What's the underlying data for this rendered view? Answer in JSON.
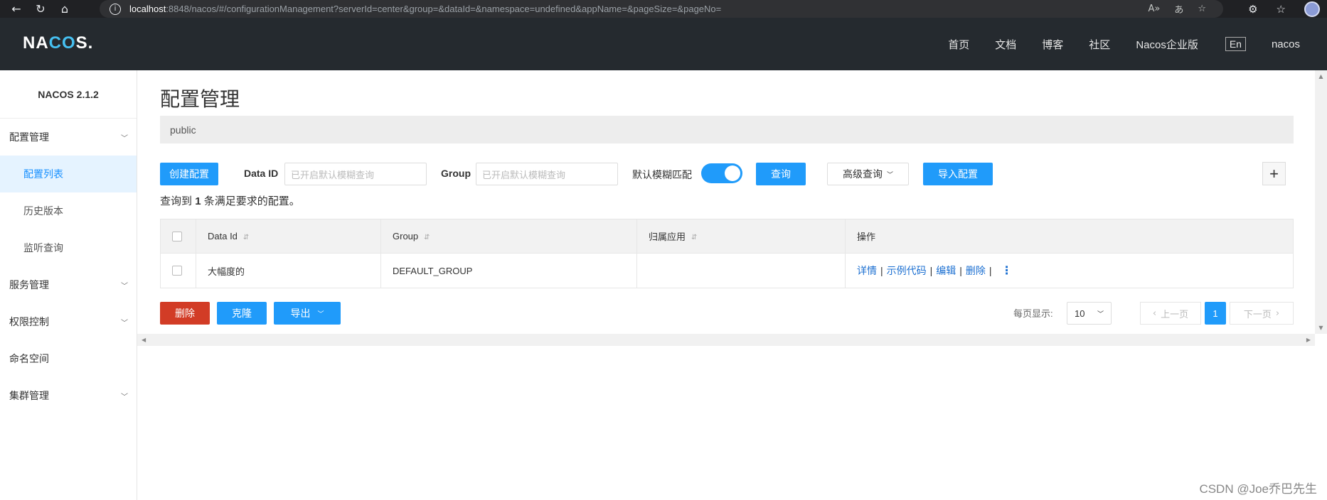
{
  "browser": {
    "back_icon": "arrow-left-icon",
    "url_host": "localhost",
    "url_path": ":8848/nacos/#/configurationManagement?serverId=center&group=&dataId=&namespace=undefined&appName=&pageSize=&pageNo="
  },
  "header": {
    "logo": "NACOS.",
    "nav": [
      "首页",
      "文档",
      "博客",
      "社区",
      "Nacos企业版"
    ],
    "lang": "En",
    "user": "nacos"
  },
  "sidebar": {
    "version": "NACOS 2.1.2",
    "items": [
      {
        "label": "配置管理",
        "expandable": true
      },
      {
        "label": "配置列表",
        "active": true
      },
      {
        "label": "历史版本"
      },
      {
        "label": "监听查询"
      },
      {
        "label": "服务管理",
        "expandable": true
      },
      {
        "label": "权限控制",
        "expandable": true
      },
      {
        "label": "命名空间",
        "expandable": false
      },
      {
        "label": "集群管理",
        "expandable": true
      }
    ]
  },
  "main": {
    "title": "配置管理",
    "namespace": "public",
    "toolbar": {
      "create_label": "创建配置",
      "dataid_label": "Data ID",
      "dataid_placeholder": "已开启默认模糊查询",
      "group_label": "Group",
      "group_placeholder": "已开启默认模糊查询",
      "fuzzy_label": "默认模糊匹配",
      "fuzzy_on": true,
      "query_label": "查询",
      "advanced_label": "高级查询",
      "import_label": "导入配置",
      "plus_label": "+"
    },
    "result": {
      "prefix": "查询到",
      "count": "1",
      "suffix": "条满足要求的配置。"
    },
    "table": {
      "headers": [
        "Data Id",
        "Group",
        "归属应用",
        "操作"
      ],
      "rows": [
        {
          "data_id": "大幅度的",
          "group": "DEFAULT_GROUP",
          "app": "",
          "ops": [
            "详情",
            "示例代码",
            "编辑",
            "删除"
          ]
        }
      ]
    },
    "bottom": {
      "delete_label": "删除",
      "clone_label": "克隆",
      "export_label": "导出",
      "pagesize_label": "每页显示:",
      "pagesize_value": "10",
      "prev_label": "上一页",
      "current_page": "1",
      "next_label": "下一页"
    }
  },
  "watermark": "CSDN @Joe乔巴先生",
  "colors": {
    "primary": "#209bfa",
    "danger": "#d23c26",
    "header_bg": "#252a2f"
  }
}
